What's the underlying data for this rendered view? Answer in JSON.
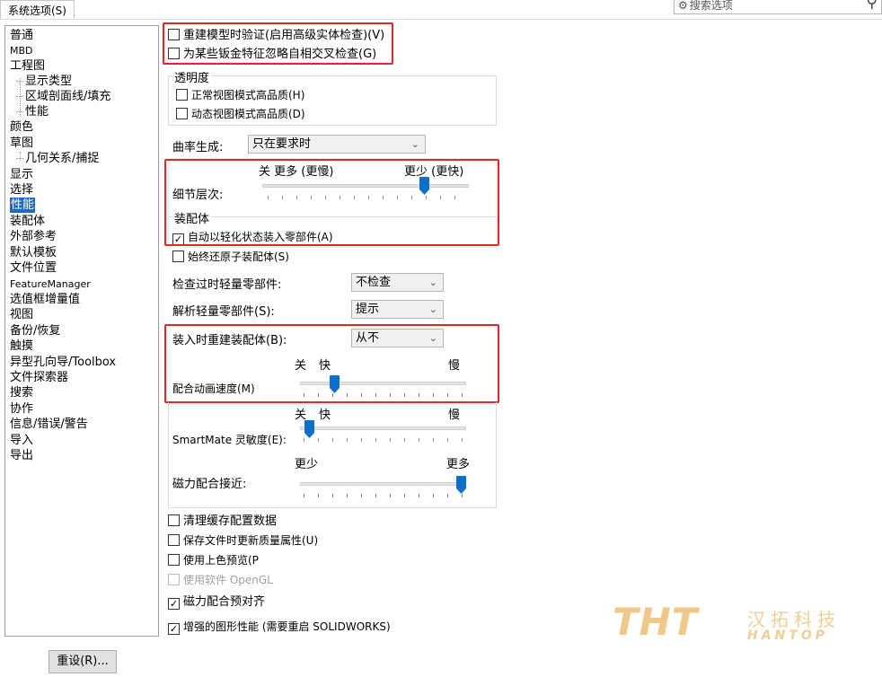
{
  "tab": {
    "label": "系统选项(S)"
  },
  "search": {
    "placeholder": "搜索选项"
  },
  "sidebar": {
    "items": [
      {
        "label": "普通"
      },
      {
        "label": "MBD"
      },
      {
        "label": "工程图"
      },
      {
        "label": "显示类型"
      },
      {
        "label": "区域剖面线/填充"
      },
      {
        "label": "性能"
      },
      {
        "label": "颜色"
      },
      {
        "label": "草图"
      },
      {
        "label": "几何关系/捕捉"
      },
      {
        "label": "显示"
      },
      {
        "label": "选择"
      },
      {
        "label": "性能"
      },
      {
        "label": "装配体"
      },
      {
        "label": "外部参考"
      },
      {
        "label": "默认模板"
      },
      {
        "label": "文件位置"
      },
      {
        "label": "FeatureManager"
      },
      {
        "label": "选值框增量值"
      },
      {
        "label": "视图"
      },
      {
        "label": "备份/恢复"
      },
      {
        "label": "触摸"
      },
      {
        "label": "异型孔向导/Toolbox"
      },
      {
        "label": "文件探索器"
      },
      {
        "label": "搜索"
      },
      {
        "label": "协作"
      },
      {
        "label": "信息/错误/警告"
      },
      {
        "label": "导入"
      },
      {
        "label": "导出"
      }
    ],
    "reset_label": "重设(R)..."
  },
  "main": {
    "rebuild_verify": {
      "label": "重建模型时验证(启用高级实体检查)(V)",
      "checked": false
    },
    "ignore_sheetmetal": {
      "label": "为某些钣金特征忽略自相交叉检查(G)",
      "checked": false
    },
    "transparency": {
      "title": "透明度",
      "normal": {
        "label": "正常视图模式高品质(H)",
        "checked": false
      },
      "dynamic": {
        "label": "动态视图模式高品质(D)",
        "checked": false
      }
    },
    "curvature": {
      "label": "曲率生成:",
      "value": "只在要求时"
    },
    "level_of_detail": {
      "label": "细节层次:",
      "left_label": "关 更多 (更慢)",
      "right_label": "更少 (更快)",
      "value_fraction": 0.8
    },
    "assembly": {
      "title": "装配体",
      "auto_lightweight": {
        "label": "自动以轻化状态装入零部件(A)",
        "checked": true
      },
      "always_resolve": {
        "label": "始终还原子装配体(S)",
        "checked": false
      },
      "check_outdated": {
        "label": "检查过时轻量零部件:",
        "value": "不检查"
      },
      "resolve_lightweight": {
        "label": "解析轻量零部件(S):",
        "value": "提示"
      },
      "rebuild_on_load": {
        "label": "装入时重建装配体(B):",
        "value": "从不"
      },
      "mate_animation": {
        "label": "配合动画速度(M)",
        "off_label": "关",
        "fast_label": "快",
        "slow_label": "慢",
        "value_fraction": 0.19
      },
      "smartmate": {
        "label": "SmartMate 灵敏度(E):",
        "off_label": "关",
        "fast_label": "快",
        "slow_label": "慢",
        "value_fraction": 0.03
      },
      "magnetic_proximity": {
        "label": "磁力配合接近:",
        "less_label": "更少",
        "more_label": "更多",
        "value_fraction": 1.0
      }
    },
    "purge_cache": {
      "label": "清理缓存配置数据",
      "checked": false
    },
    "update_mass": {
      "label": "保存文件时更新质量属性(U)",
      "checked": false
    },
    "shaded_preview": {
      "label": "使用上色预览(P",
      "checked": false
    },
    "software_opengl": {
      "label": "使用软件 OpenGL",
      "checked": false,
      "enabled": false
    },
    "magnetic_prealign": {
      "label": "磁力配合预对齐",
      "checked": true
    },
    "enhanced_graphics": {
      "label": "增强的图形性能 (需要重启 SOLIDWORKS)",
      "checked": true
    }
  },
  "watermark": {
    "brand": "THT",
    "cn": "汉拓科技",
    "en": "HANTOP"
  },
  "colors": {
    "highlight": "#e2262a",
    "selected": "#1e69c8",
    "slider_thumb": "#0c6fc9"
  }
}
